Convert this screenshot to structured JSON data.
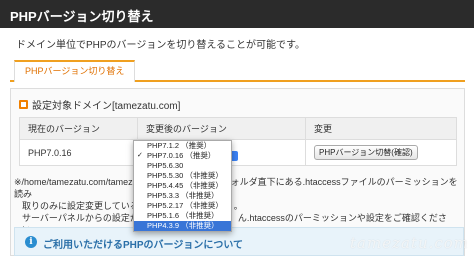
{
  "header": {
    "title": "PHPバージョン切り替え"
  },
  "intro": "ドメイン単位でPHPのバージョンを切り替えることが可能です。",
  "tab": {
    "label": "PHPバージョン切り替え"
  },
  "section": {
    "title": "設定対象ドメイン[tamezatu.com]"
  },
  "table": {
    "headers": [
      "現在のバージョン",
      "変更後のバージョン",
      "変更"
    ],
    "current_version": "PHP7.0.16",
    "button_label": "PHPバージョン切替(確認)"
  },
  "dropdown": {
    "options": [
      {
        "label": "PHP7.1.2 （推奨）",
        "checked": false,
        "selected": false
      },
      {
        "label": "PHP7.0.16 （推奨）",
        "checked": true,
        "selected": false
      },
      {
        "label": "PHP5.6.30",
        "checked": false,
        "selected": false
      },
      {
        "label": "PHP5.5.30 （非推奨）",
        "checked": false,
        "selected": false
      },
      {
        "label": "PHP5.4.45 （非推奨）",
        "checked": false,
        "selected": false
      },
      {
        "label": "PHP5.3.3 （非推奨）",
        "checked": false,
        "selected": false
      },
      {
        "label": "PHP5.2.17 （非推奨）",
        "checked": false,
        "selected": false
      },
      {
        "label": "PHP5.1.6 （非推奨）",
        "checked": false,
        "selected": false
      },
      {
        "label": "PHP4.3.9 （非推奨）",
        "checked": false,
        "selected": true
      }
    ]
  },
  "notes": {
    "line1_start": "※/home/tamezatu.com/tamez",
    "line1_end": "ォルダ直下にある.htaccessファイルのパーミッションを読み",
    "line2_start": "取りのみに設定変更している場",
    "line2_end": "。",
    "line3_start": "サーバーパネルからの設定が反",
    "line3_end": "ん.htaccessのパーミッションや設定をご確認ください。"
  },
  "info": {
    "icon": "info-icon",
    "text": "ご利用いただけるPHPのバージョンについて"
  },
  "watermark": "tamezatu.com",
  "colors": {
    "header_bg": "#2b2b2b",
    "accent": "#f0a020",
    "selected": "#3875d7",
    "info": "#2a8dd0"
  }
}
